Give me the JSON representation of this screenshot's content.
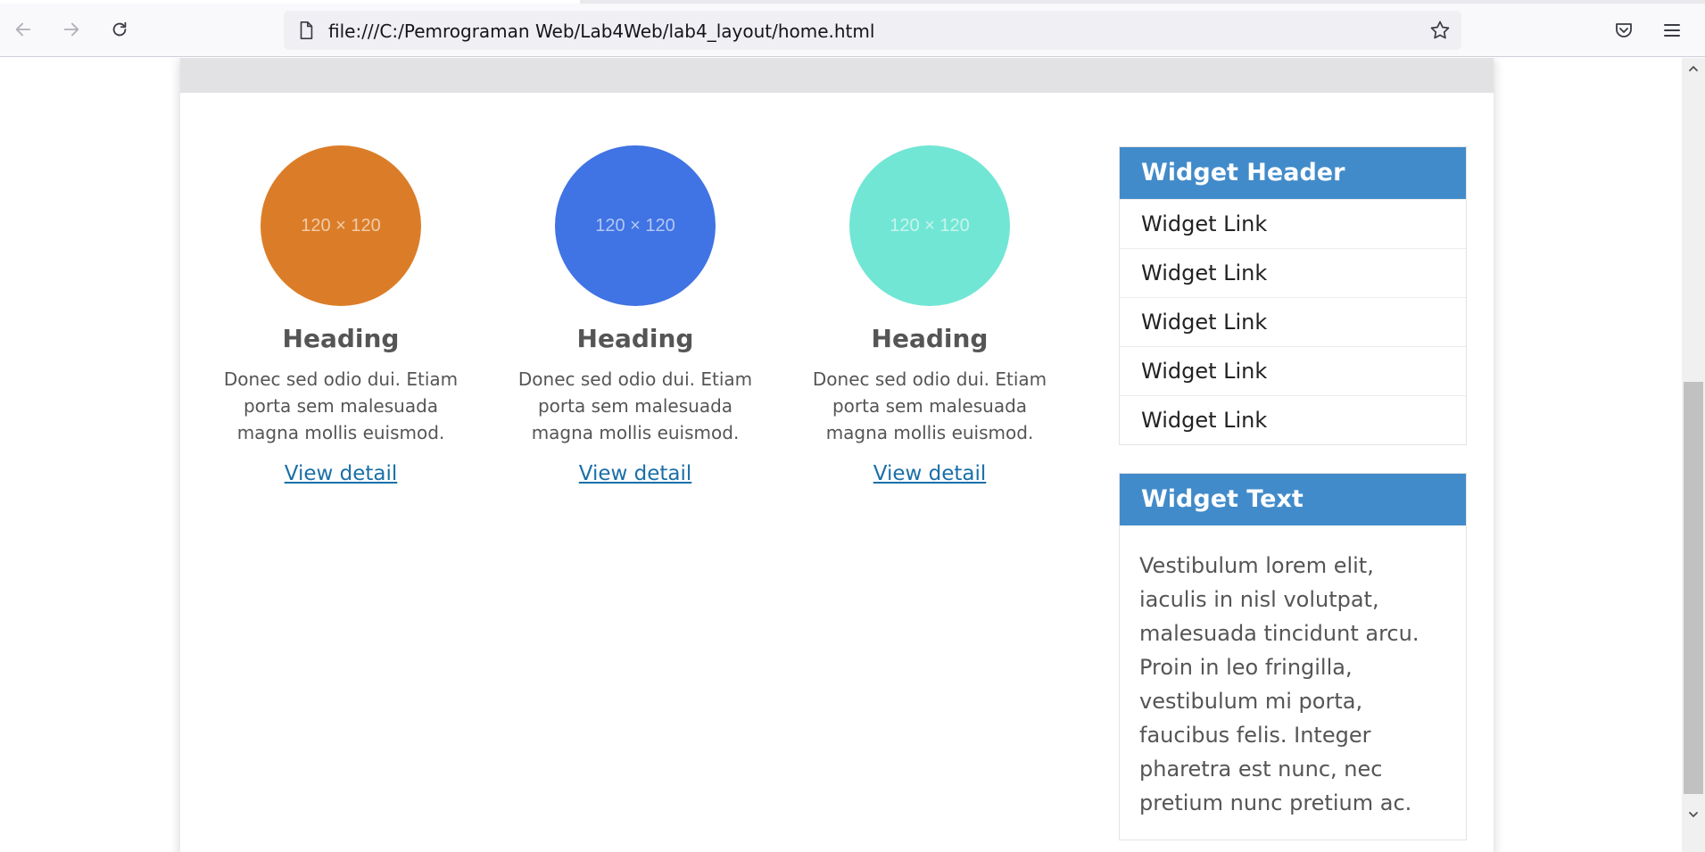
{
  "browser": {
    "url": "file:///C:/Pemrograman Web/Lab4Web/lab4_layout/home.html"
  },
  "features": [
    {
      "placeholder": "120 × 120",
      "color": "#db7d28",
      "heading": "Heading",
      "text": "Donec sed odio dui. Etiam porta sem malesuada magna mollis euismod.",
      "link": "View detail"
    },
    {
      "placeholder": "120 × 120",
      "color": "#4073e3",
      "heading": "Heading",
      "text": "Donec sed odio dui. Etiam porta sem malesuada magna mollis euismod.",
      "link": "View detail"
    },
    {
      "placeholder": "120 × 120",
      "color": "#72e6d5",
      "heading": "Heading",
      "text": "Donec sed odio dui. Etiam porta sem malesuada magna mollis euismod.",
      "link": "View detail"
    }
  ],
  "widget_links": {
    "header": "Widget Header",
    "links": [
      "Widget Link",
      "Widget Link",
      "Widget Link",
      "Widget Link",
      "Widget Link"
    ]
  },
  "widget_text": {
    "header": "Widget Text",
    "body": "Vestibulum lorem elit, iaculis in nisl volutpat, malesuada tincidunt arcu. Proin in leo fringilla, vestibulum mi porta, faucibus felis. Integer pharetra est nunc, nec pretium nunc pretium ac."
  },
  "colors": {
    "widget_header": "#428bca",
    "link": "#1a6fa8"
  }
}
